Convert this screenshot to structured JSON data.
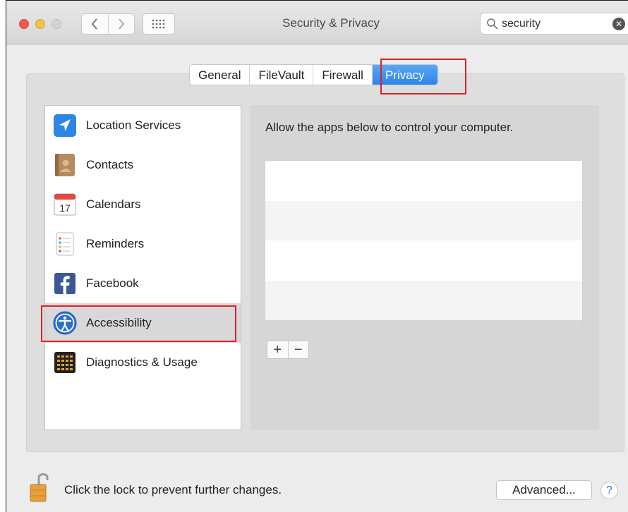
{
  "window": {
    "title": "Security & Privacy",
    "search": {
      "value": "security",
      "placeholder": "Search"
    }
  },
  "tabs": [
    {
      "label": "General"
    },
    {
      "label": "FileVault"
    },
    {
      "label": "Firewall"
    },
    {
      "label": "Privacy",
      "selected": true
    }
  ],
  "sidebar": {
    "items": [
      {
        "label": "Location Services",
        "icon": "location-arrow-icon"
      },
      {
        "label": "Contacts",
        "icon": "contacts-book-icon"
      },
      {
        "label": "Calendars",
        "icon": "calendar-icon",
        "icon_text": "17"
      },
      {
        "label": "Reminders",
        "icon": "reminders-list-icon"
      },
      {
        "label": "Facebook",
        "icon": "facebook-icon"
      },
      {
        "label": "Accessibility",
        "icon": "accessibility-icon",
        "selected": true
      },
      {
        "label": "Diagnostics & Usage",
        "icon": "diagnostics-grid-icon"
      }
    ]
  },
  "main": {
    "description": "Allow the apps below to control your computer.",
    "add_label": "+",
    "remove_label": "−"
  },
  "footer": {
    "lock_text": "Click the lock to prevent further changes.",
    "advanced_label": "Advanced...",
    "help_label": "?"
  },
  "colors": {
    "accent": "#2c84ec",
    "highlight_box": "#e0202a"
  }
}
